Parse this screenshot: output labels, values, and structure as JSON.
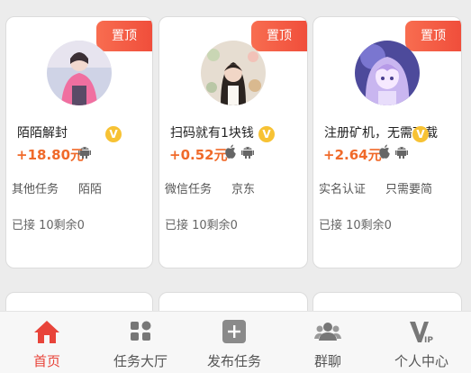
{
  "colors": {
    "accent": "#e8443a",
    "price": "#f06a2a",
    "pin": "#f04e3b",
    "badge": "#f7c234"
  },
  "cards": [
    {
      "pin_label": "置顶",
      "avatar": "avatar-girl-pink-jacket",
      "title": "陌陌解封",
      "verified_icon": "v-badge-icon",
      "verified_label": "V",
      "price": "+18.80元",
      "platforms": [
        "android-icon"
      ],
      "tags": [
        "其他任务",
        "陌陌"
      ],
      "stats": "已接 10剩余0"
    },
    {
      "pin_label": "置顶",
      "avatar": "avatar-girl-photo",
      "title": "扫码就有1块钱",
      "verified_icon": "v-badge-icon",
      "verified_label": "V",
      "price": "+0.52元",
      "platforms": [
        "apple-icon",
        "android-icon"
      ],
      "tags": [
        "微信任务",
        "京东"
      ],
      "stats": "已接 10剩余0"
    },
    {
      "pin_label": "置顶",
      "avatar": "avatar-anime-purple",
      "title": "注册矿机，无需下载",
      "verified_icon": "v-badge-icon",
      "verified_label": "V",
      "price": "+2.64元",
      "platforms": [
        "apple-icon",
        "android-icon"
      ],
      "tags": [
        "实名认证",
        "只需要简"
      ],
      "stats": "已接 10剩余0"
    }
  ],
  "tabbar": {
    "active_index": 0,
    "items": [
      {
        "label": "首页",
        "icon": "home-icon"
      },
      {
        "label": "任务大厅",
        "icon": "task-hall-icon"
      },
      {
        "label": "发布任务",
        "icon": "publish-plus-icon"
      },
      {
        "label": "群聊",
        "icon": "group-chat-icon"
      },
      {
        "label": "个人中心",
        "icon": "vip-icon"
      }
    ]
  }
}
